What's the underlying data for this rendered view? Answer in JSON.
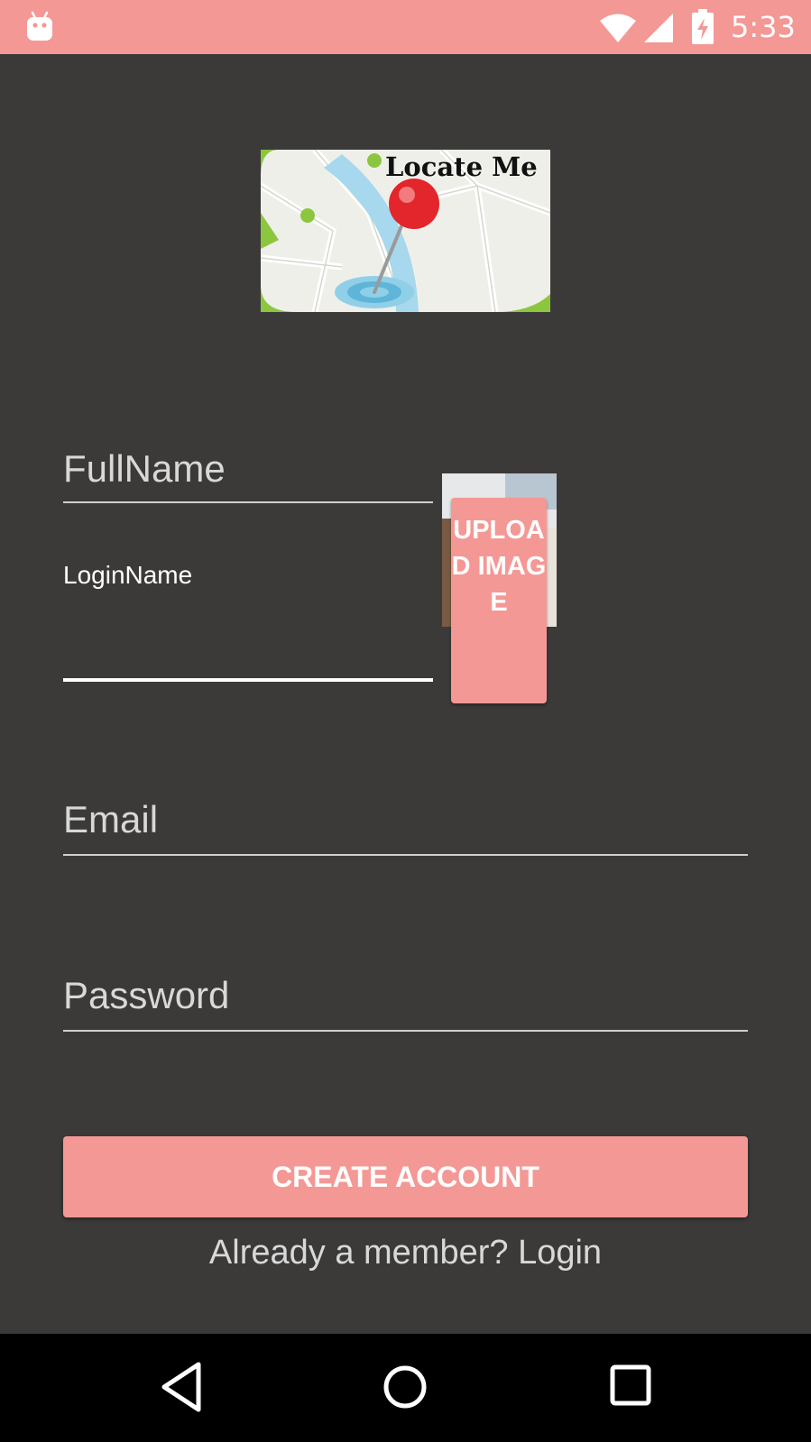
{
  "status_bar": {
    "time": "5:33",
    "color": "#f49895",
    "icons": [
      "android-icon",
      "wifi-icon",
      "signal-icon",
      "battery-charging-icon"
    ]
  },
  "logo": {
    "title": "Locate Me",
    "colors": {
      "map_green": "#8cc63f",
      "pin_red": "#e2262b",
      "water_blue": "#a7d8ee"
    }
  },
  "form": {
    "fullname_placeholder": "FullName",
    "loginname_label": "LoginName",
    "loginname_value": "",
    "email_placeholder": "Email",
    "password_placeholder": "Password"
  },
  "upload": {
    "label": "UPLOAD IMAGE"
  },
  "actions": {
    "create_account": "CREATE ACCOUNT",
    "login_prompt": "Already a member? Login"
  },
  "nav_bar": {
    "icons": [
      "back-icon",
      "home-icon",
      "recent-apps-icon"
    ]
  },
  "theme": {
    "background": "#3b3a39",
    "accent": "#f49895",
    "text": "#d8d8d8"
  }
}
